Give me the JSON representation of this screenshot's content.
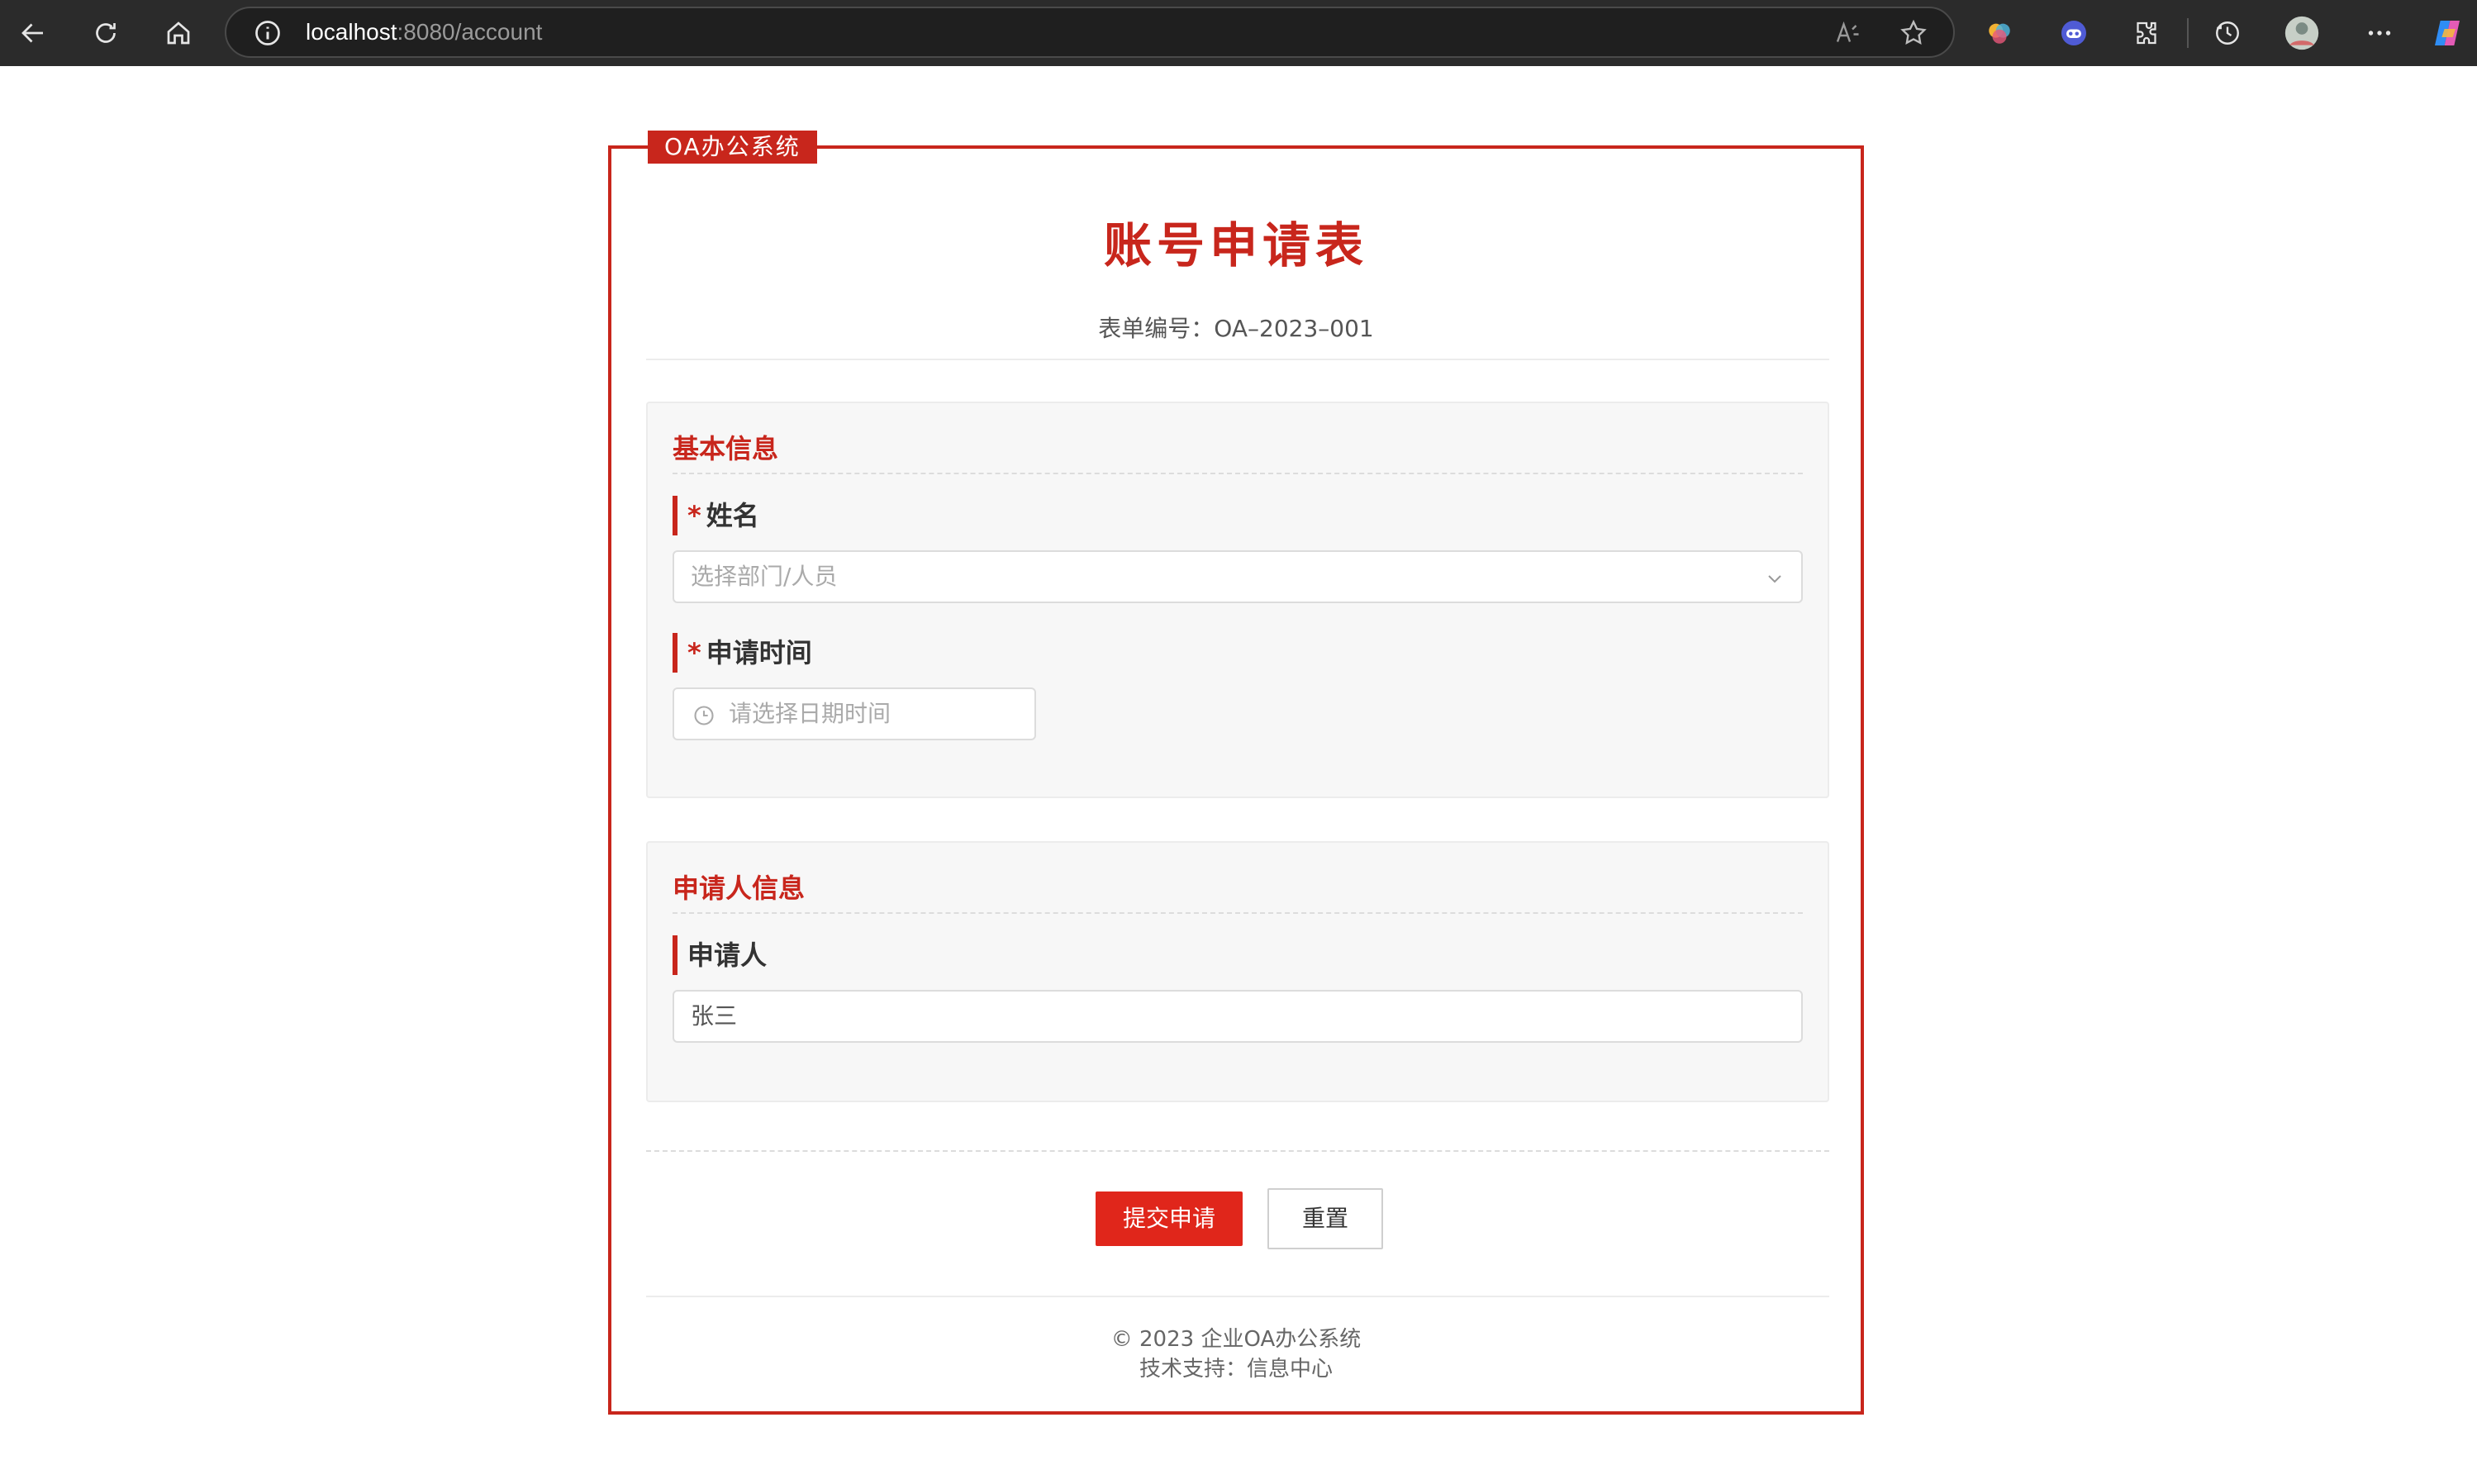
{
  "browser": {
    "url_host": "localhost",
    "url_rest": ":8080/account"
  },
  "form": {
    "brand_tag": "OA办公系统",
    "title": "账号申请表",
    "form_number": "表单编号：OA–2023–001"
  },
  "sections": {
    "basic": {
      "title": "基本信息",
      "name_label": "姓名",
      "name_placeholder": "选择部门/人员",
      "time_label": "申请时间",
      "time_placeholder": "请选择日期时间"
    },
    "applicant": {
      "title": "申请人信息",
      "applicant_label": "申请人",
      "applicant_value": "张三"
    }
  },
  "actions": {
    "submit_label": "提交申请",
    "reset_label": "重置"
  },
  "footer": {
    "copyright": "© 2023 企业OA办公系统",
    "support": "技术支持：信息中心"
  },
  "colors": {
    "accent": "#c8261c",
    "primary_button": "#e0261b"
  }
}
